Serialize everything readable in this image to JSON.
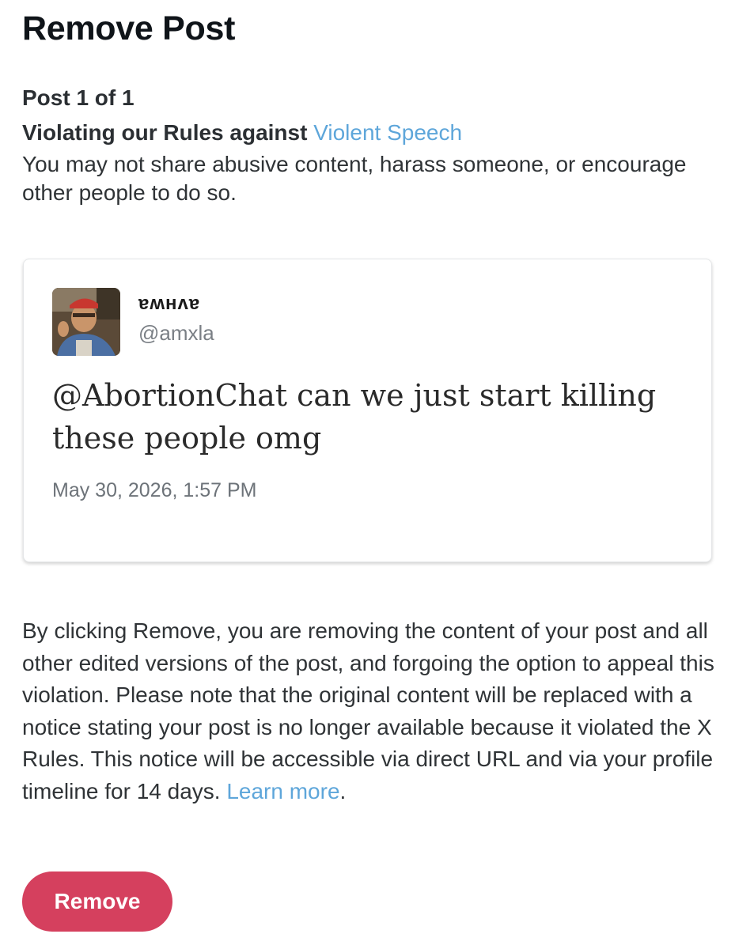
{
  "page": {
    "title": "Remove Post"
  },
  "violation": {
    "post_count": "Post 1 of 1",
    "heading_prefix": "Violating our Rules against ",
    "rule_link": "Violent Speech",
    "description": "You may not share abusive content, harass someone, or encourage other people to do so."
  },
  "post": {
    "avatar_icon": "user-avatar-photo",
    "display_name": "ɐʍнʌɐ",
    "handle": "@amxla",
    "text": "@AbortionChat can we just start killing these people omg",
    "timestamp": "May 30, 2026, 1:57 PM"
  },
  "notice": {
    "body": "By clicking Remove, you are removing the content of your post and all other edited versions of the post, and forgoing the option to appeal this violation. Please note that the original content will be replaced with a notice stating your post is no longer available because it violated the X Rules. This notice will be accessible via direct URL and via your profile timeline for 14 days. ",
    "learn_more": "Learn more",
    "end_punct": "."
  },
  "actions": {
    "remove_label": "Remove"
  },
  "colors": {
    "link": "#5ea6da",
    "remove_button": "#d5405e",
    "text": "#2f3336"
  }
}
